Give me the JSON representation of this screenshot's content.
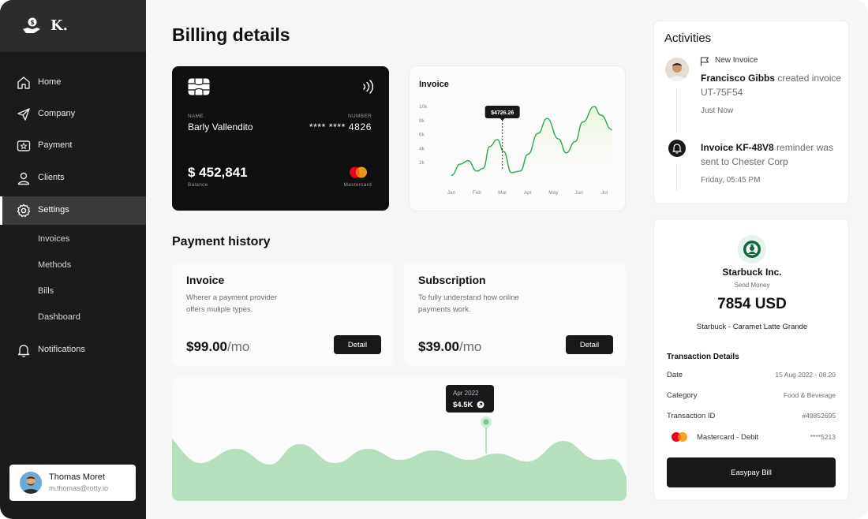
{
  "brand": {
    "name": "K."
  },
  "sidebar": {
    "items": [
      {
        "label": "Home",
        "icon": "home-icon"
      },
      {
        "label": "Company",
        "icon": "send-icon"
      },
      {
        "label": "Payment",
        "icon": "payment-icon"
      },
      {
        "label": "Clients",
        "icon": "user-icon"
      },
      {
        "label": "Settings",
        "icon": "gear-icon",
        "active": true
      }
    ],
    "sub_items": [
      "Invoices",
      "Methods",
      "Bills",
      "Dashboard"
    ],
    "notifications": "Notifications",
    "user": {
      "name": "Thomas Moret",
      "email": "m.thomas@rotty.io"
    }
  },
  "main": {
    "title": "Billing details",
    "card": {
      "name_label": "NAME",
      "name": "Barly Vallendito",
      "number_label": "NUMBER",
      "number": "****  ****  4826",
      "balance": "$ 452,841",
      "balance_label": "Balance",
      "network": "Mastercard"
    },
    "invoice_chart": {
      "title": "Invoice",
      "tooltip": "$4726.26"
    },
    "payment_history": {
      "title": "Payment history",
      "cards": [
        {
          "title": "Invoice",
          "desc": "Wherer a payment provider offers muliple types.",
          "price": "$99.00",
          "unit": "/mo",
          "button": "Detail"
        },
        {
          "title": "Subscription",
          "desc": "To fully understand how online payments work.",
          "price": "$39.00",
          "unit": "/mo",
          "button": "Detail"
        }
      ]
    },
    "area_tooltip": {
      "month": "Apr 2022",
      "value": "$4.5K"
    }
  },
  "chart_data": {
    "type": "area",
    "title": "Invoice",
    "categories": [
      "Jan",
      "Feb",
      "Mar",
      "Apr",
      "May",
      "Jun",
      "Jul"
    ],
    "y_ticks": [
      "10k",
      "8k",
      "6k",
      "4k",
      "2k"
    ],
    "ylim": [
      0,
      11000
    ],
    "x": [
      0,
      0.35,
      0.65,
      1.0,
      1.25,
      1.5,
      1.8,
      2.05,
      2.35,
      2.7,
      3.0,
      3.4,
      3.75,
      4.2,
      4.5,
      4.85,
      5.15,
      5.6,
      5.85,
      6.3
    ],
    "values": [
      1200,
      2800,
      3300,
      1800,
      2200,
      5300,
      6300,
      4600,
      1600,
      1800,
      4200,
      7200,
      9300,
      6400,
      4400,
      6000,
      8800,
      11000,
      9800,
      7700
    ],
    "annotation": {
      "x": 2.0,
      "label": "$4726.26"
    },
    "grid": false,
    "legend": "none"
  },
  "activities": {
    "title": "Activities",
    "items": [
      {
        "tag": "New Invoice",
        "actor": "Francisco Gibbs",
        "text": "created invoice UT-75F54",
        "time": "Just Now"
      },
      {
        "actor": "Invoice KF-48V8",
        "text": "reminder was sent to Chester Corp",
        "time": "Friday, 05:45 PM"
      }
    ]
  },
  "receipt": {
    "merchant": "Starbuck Inc.",
    "subtitle": "Send Money",
    "amount": "7854 USD",
    "item": "Starbuck - Caramet Latte Grande",
    "details_title": "Transaction Details",
    "rows": [
      {
        "label": "Date",
        "value": "15 Aug 2022 - 08.20"
      },
      {
        "label": "Category",
        "value": "Food & Beverage"
      },
      {
        "label": "Transaction ID",
        "value": "#49852695"
      },
      {
        "label": "Mastercard - Debit",
        "value": "****5213"
      }
    ],
    "button": "Easypay Bill"
  },
  "colors": {
    "accent_green": "#2fa84f",
    "area_green": "#b6e0bd",
    "dark": "#18181b"
  }
}
